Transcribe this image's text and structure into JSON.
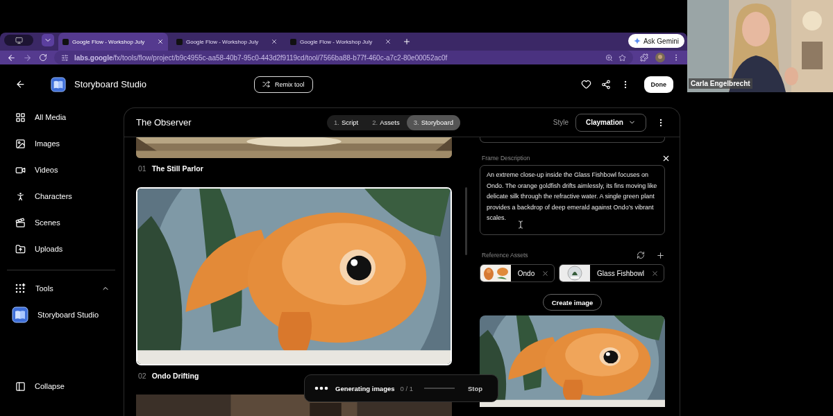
{
  "browser": {
    "tabs": [
      {
        "title": "Google Flow - Workshop July",
        "selected": true
      },
      {
        "title": "Google Flow - Workshop July",
        "selected": false
      },
      {
        "title": "Google Flow - Workshop July",
        "selected": false
      }
    ],
    "url": "**labs.google**/fx/tools/flow/project/b9c4955c-aa58-40b7-95c0-443d2f9119cd/tool/7566ba88-b77f-460c-a7c2-80e00052ac0f",
    "ask_gemini": "Ask Gemini"
  },
  "app": {
    "title": "Storyboard Studio",
    "remix": "Remix tool",
    "done": "Done"
  },
  "sidebar": {
    "items": [
      {
        "label": "All Media"
      },
      {
        "label": "Images"
      },
      {
        "label": "Videos"
      },
      {
        "label": "Characters"
      },
      {
        "label": "Scenes"
      },
      {
        "label": "Uploads"
      }
    ],
    "tools_label": "Tools",
    "tools_expanded": true,
    "tools": [
      {
        "label": "Storyboard Studio"
      }
    ],
    "collapse": "Collapse"
  },
  "project": {
    "title": "The Observer",
    "steps": [
      {
        "number": "1.",
        "label": "Script",
        "selected": false
      },
      {
        "number": "2.",
        "label": "Assets",
        "selected": false
      },
      {
        "number": "3.",
        "label": "Storyboard",
        "selected": true
      }
    ],
    "style_label": "Style",
    "style_value": "Claymation"
  },
  "frames": [
    {
      "kind": "picture",
      "number": "01",
      "title": "The Still Parlor",
      "selected": false
    },
    {
      "kind": "picture",
      "number": "02",
      "title": "Ondo Drifting",
      "selected": true
    },
    {
      "kind": "picture",
      "selected": false
    }
  ],
  "detail": {
    "description_label": "Frame Description",
    "description": "An extreme close-up inside the Glass Fishbowl focuses on Ondo. The orange goldfish drifts aimlessly, its fins moving like delicate silk through the refractive water. A single green plant provides a backdrop of deep emerald against Ondo’s vibrant scales.",
    "assets_label": "Reference Assets",
    "assets": [
      {
        "name": "Ondo"
      },
      {
        "name": "Glass Fishbowl"
      }
    ],
    "create": "Create image"
  },
  "toast": {
    "text": "Generating images",
    "count": "0 / 1",
    "level": 0,
    "stop": "Stop"
  },
  "video": {
    "name": "Carla Engelbrecht"
  }
}
